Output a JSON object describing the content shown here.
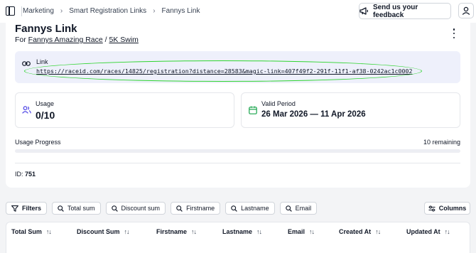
{
  "breadcrumb": [
    "Marketing",
    "Smart Registration Links",
    "Fannys Link"
  ],
  "feedback_label": "Send us your feedback",
  "page": {
    "title": "Fannys Link",
    "subtitle_prefix": "For",
    "race_name": "Fannys Amazing Race",
    "separator": "/",
    "distance_name": "5K Swim"
  },
  "link": {
    "label": "Link",
    "url": "https://raceid.com/races/14825/registration?distance=28583&magic-link=407f49f2-291f-11f1-af38-0242ac1c0002"
  },
  "usage": {
    "label": "Usage",
    "value": "0/10"
  },
  "valid_period": {
    "label": "Valid Period",
    "value": "26 Mar 2026 — 11 Apr 2026"
  },
  "progress": {
    "label": "Usage Progress",
    "remaining": "10 remaining",
    "fraction": 0
  },
  "id_info": {
    "label": "ID:",
    "value": "751"
  },
  "filters": [
    {
      "label": "Filters",
      "icon": "filter-icon"
    },
    {
      "label": "Total sum",
      "icon": "search-icon"
    },
    {
      "label": "Discount sum",
      "icon": "search-icon"
    },
    {
      "label": "Firstname",
      "icon": "search-icon"
    },
    {
      "label": "Lastname",
      "icon": "search-icon"
    },
    {
      "label": "Email",
      "icon": "search-icon"
    }
  ],
  "columns_label": "Columns",
  "table_headers": [
    "Total Sum",
    "Discount Sum",
    "Firstname",
    "Lastname",
    "Email",
    "Created At",
    "Updated At"
  ],
  "colors": {
    "accent": "#4f46e5",
    "link_bg": "#eef0fb",
    "highlight": "#2fd42f",
    "icon_blue": "#4f46e5",
    "icon_green": "#16a34a"
  }
}
